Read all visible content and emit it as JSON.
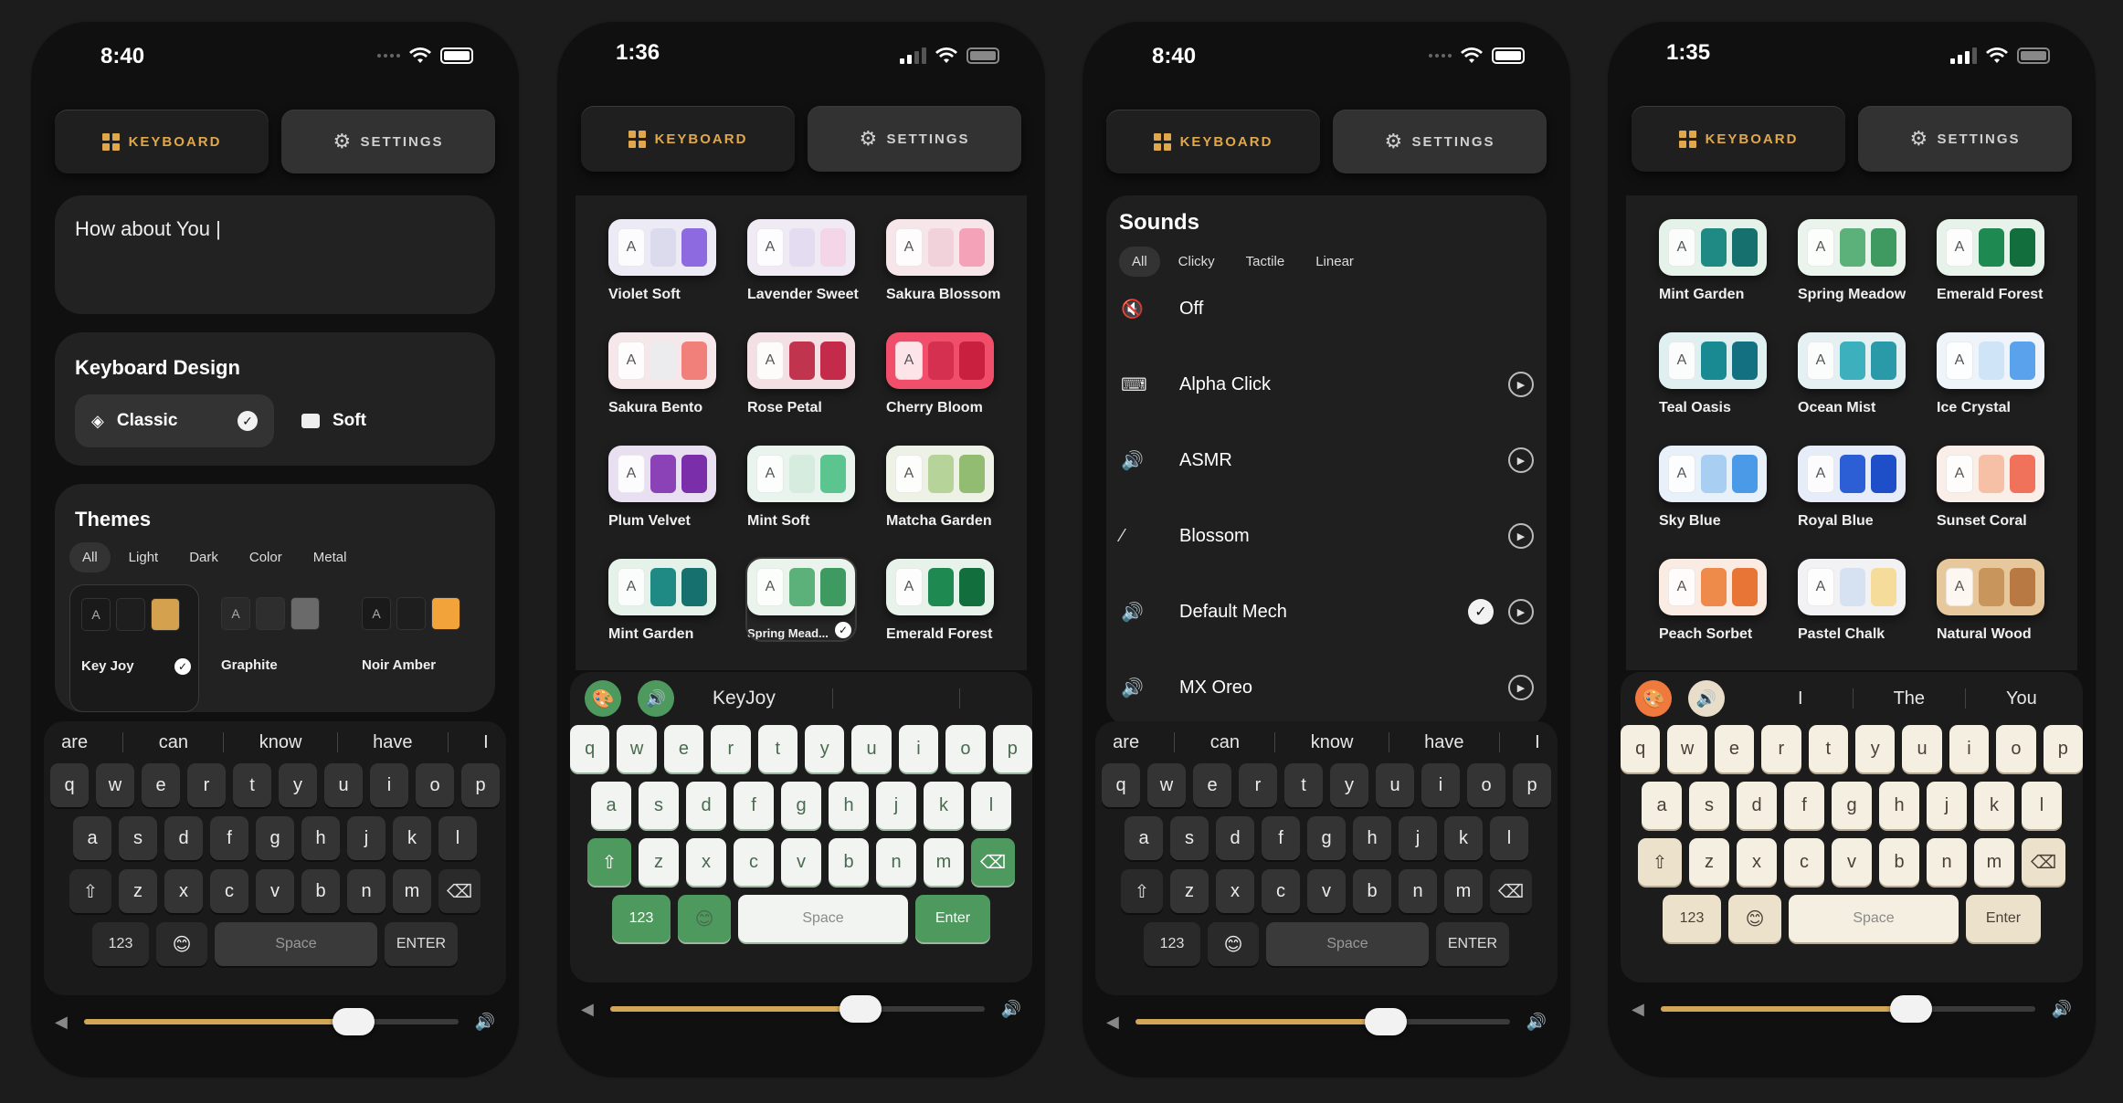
{
  "tabs": {
    "keyboard": "KEYBOARD",
    "settings": "SETTINGS"
  },
  "phone1": {
    "time": "8:40",
    "text_input": "How about You |",
    "design": {
      "title": "Keyboard Design",
      "options": [
        {
          "label": "Classic",
          "selected": true
        },
        {
          "label": "Soft",
          "selected": false
        }
      ]
    },
    "themes": {
      "title": "Themes",
      "filters": [
        "All",
        "Light",
        "Dark",
        "Color",
        "Metal"
      ],
      "active_filter": "All",
      "items": [
        {
          "name": "Key Joy",
          "selected": true,
          "colors": [
            "#1a1a1a",
            "#1e1e1e",
            "#d4a24e"
          ]
        },
        {
          "name": "Graphite",
          "selected": false,
          "colors": [
            "#2a2a2a",
            "#2e2e2e",
            "#6a6a6a"
          ]
        },
        {
          "name": "Noir Amber",
          "selected": false,
          "colors": [
            "#1a1a1a",
            "#1e1e1e",
            "#f2a43a"
          ]
        }
      ]
    },
    "suggestions": [
      "are",
      "can",
      "know",
      "have",
      "I"
    ],
    "keys": {
      "row1": [
        "q",
        "w",
        "e",
        "r",
        "t",
        "y",
        "u",
        "i",
        "o",
        "p"
      ],
      "row2": [
        "a",
        "s",
        "d",
        "f",
        "g",
        "h",
        "j",
        "k",
        "l"
      ],
      "row3": [
        "z",
        "x",
        "c",
        "v",
        "b",
        "n",
        "m"
      ],
      "num": "123",
      "space": "Space",
      "enter": "ENTER"
    },
    "volume": 0.72
  },
  "phone2": {
    "time": "1:36",
    "themes": [
      {
        "name": "Violet Soft",
        "colors": [
          "#ecebf5",
          "#dcdbee",
          "#8e6ae0"
        ]
      },
      {
        "name": "Lavender Sweet",
        "colors": [
          "#efeaf4",
          "#e4dcf0",
          "#f3d6e8"
        ]
      },
      {
        "name": "Sakura Blossom",
        "colors": [
          "#f6e6ea",
          "#f2d2da",
          "#f4a2b8"
        ]
      },
      {
        "name": "Sakura Bento",
        "colors": [
          "#f6e8ea",
          "#ececee",
          "#f2807a"
        ]
      },
      {
        "name": "Rose Petal",
        "colors": [
          "#f4e0e4",
          "#c0344e",
          "#c42a4a"
        ]
      },
      {
        "name": "Cherry Bloom",
        "colors": [
          "#f04e6a",
          "#d63050",
          "#c8203e"
        ]
      },
      {
        "name": "Plum Velvet",
        "colors": [
          "#e8e0f0",
          "#8a42b6",
          "#7a2eaa"
        ]
      },
      {
        "name": "Mint Soft",
        "colors": [
          "#eaf4ee",
          "#d6ecdf",
          "#5cc48e"
        ]
      },
      {
        "name": "Matcha Garden",
        "colors": [
          "#eef2e6",
          "#b6d49a",
          "#92bc72"
        ]
      },
      {
        "name": "Mint Garden",
        "colors": [
          "#e4f2ea",
          "#1f8a84",
          "#16706e"
        ]
      },
      {
        "name": "Spring Mead...",
        "colors": [
          "#eaf4ec",
          "#5cb07a",
          "#3e9a60"
        ],
        "selected": true
      },
      {
        "name": "Emerald Forest",
        "colors": [
          "#e6f2ea",
          "#1e8a52",
          "#126e3c"
        ]
      }
    ],
    "suggestion": "KeyJoy",
    "keys": {
      "row1": [
        "q",
        "w",
        "e",
        "r",
        "t",
        "y",
        "u",
        "i",
        "o",
        "p"
      ],
      "row2": [
        "a",
        "s",
        "d",
        "f",
        "g",
        "h",
        "j",
        "k",
        "l"
      ],
      "row3": [
        "z",
        "x",
        "c",
        "v",
        "b",
        "n",
        "m"
      ],
      "num": "123",
      "space": "Space",
      "enter": "Enter"
    },
    "accent": "#4e9a5e",
    "volume": 0.67
  },
  "phone3": {
    "time": "8:40",
    "sounds": {
      "title": "Sounds",
      "filters": [
        "All",
        "Clicky",
        "Tactile",
        "Linear"
      ],
      "active_filter": "All",
      "items": [
        {
          "label": "Off",
          "icon": "mute-icon",
          "glyph": "🔇",
          "play": false,
          "selected": false
        },
        {
          "label": "Alpha Click",
          "icon": "keyboard-icon",
          "glyph": "⌨",
          "play": true,
          "selected": false
        },
        {
          "label": "ASMR",
          "icon": "speaker-icon",
          "glyph": "🔊",
          "play": true,
          "selected": false
        },
        {
          "label": "Blossom",
          "icon": "slash-icon",
          "glyph": "⁄",
          "play": true,
          "selected": false
        },
        {
          "label": "Default Mech",
          "icon": "speaker-icon",
          "glyph": "🔊",
          "play": true,
          "selected": true
        },
        {
          "label": "MX Oreo",
          "icon": "speaker-icon",
          "glyph": "🔊",
          "play": true,
          "selected": false
        }
      ]
    },
    "suggestions": [
      "are",
      "can",
      "know",
      "have",
      "I"
    ],
    "keys": {
      "row1": [
        "q",
        "w",
        "e",
        "r",
        "t",
        "y",
        "u",
        "i",
        "o",
        "p"
      ],
      "row2": [
        "a",
        "s",
        "d",
        "f",
        "g",
        "h",
        "j",
        "k",
        "l"
      ],
      "row3": [
        "z",
        "x",
        "c",
        "v",
        "b",
        "n",
        "m"
      ],
      "num": "123",
      "space": "Space",
      "enter": "ENTER"
    },
    "volume": 0.67
  },
  "phone4": {
    "time": "1:35",
    "themes": [
      {
        "name": "Mint Garden",
        "colors": [
          "#e4f2ea",
          "#1f8a84",
          "#16706e"
        ]
      },
      {
        "name": "Spring Meadow",
        "colors": [
          "#eaf4ec",
          "#5cb07a",
          "#3e9a60"
        ]
      },
      {
        "name": "Emerald Forest",
        "colors": [
          "#e6f2ea",
          "#1e8a52",
          "#126e3c"
        ]
      },
      {
        "name": "Teal Oasis",
        "colors": [
          "#e0f0f0",
          "#1a8a92",
          "#127080"
        ]
      },
      {
        "name": "Ocean Mist",
        "colors": [
          "#e4f0f2",
          "#3cb0bc",
          "#2a9aa8"
        ]
      },
      {
        "name": "Ice Crystal",
        "colors": [
          "#eef4fa",
          "#cfe4f6",
          "#5aa2ec"
        ]
      },
      {
        "name": "Sky Blue",
        "colors": [
          "#e8f0fa",
          "#a8cff2",
          "#4a9ae8"
        ]
      },
      {
        "name": "Royal Blue",
        "colors": [
          "#e6ecf8",
          "#2c5ed6",
          "#1e4ec8"
        ]
      },
      {
        "name": "Sunset Coral",
        "colors": [
          "#faeee8",
          "#f6c0a6",
          "#f0725a"
        ]
      },
      {
        "name": "Peach Sorbet",
        "colors": [
          "#faece2",
          "#ee8a4a",
          "#e87436"
        ]
      },
      {
        "name": "Pastel Chalk",
        "colors": [
          "#f2f2f4",
          "#d6e2f2",
          "#f6dc9a"
        ]
      },
      {
        "name": "Natural Wood",
        "colors": [
          "#e6c89c",
          "#c8965c",
          "#b87a42"
        ]
      }
    ],
    "suggestions": [
      "I",
      "The",
      "You"
    ],
    "keys": {
      "row1": [
        "q",
        "w",
        "e",
        "r",
        "t",
        "y",
        "u",
        "i",
        "o",
        "p"
      ],
      "row2": [
        "a",
        "s",
        "d",
        "f",
        "g",
        "h",
        "j",
        "k",
        "l"
      ],
      "row3": [
        "z",
        "x",
        "c",
        "v",
        "b",
        "n",
        "m"
      ],
      "num": "123",
      "space": "Space",
      "enter": "Enter"
    },
    "accent": "#f07a3e",
    "volume": 0.67
  }
}
